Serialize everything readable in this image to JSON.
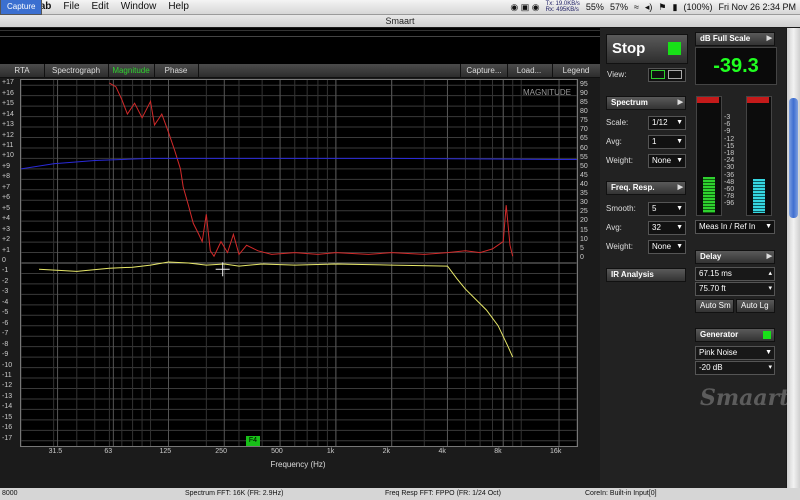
{
  "menubar": {
    "app": "Grab",
    "items": [
      "File",
      "Edit",
      "Capture",
      "Window",
      "Help"
    ],
    "selected": "Capture",
    "net_tx": "Tx: 19.0KB/s",
    "net_rx": "Rx: 495KB/s",
    "cpu": "55%",
    "mem": "57%",
    "battery": "(100%)",
    "clock": "Fri Nov 26  2:34 PM"
  },
  "window": {
    "title": "Smaart"
  },
  "tabs": {
    "left": [
      "RTA",
      "Spectrograph",
      "Magnitude",
      "Phase"
    ],
    "active": "Magnitude",
    "right": [
      "Capture...",
      "Load...",
      "Legend"
    ]
  },
  "plot": {
    "watermark": "MAGNITUDE",
    "marker": "F4",
    "xlabel": "Frequency (Hz)"
  },
  "chart_data": {
    "type": "line",
    "xscale": "log",
    "x_ticks": [
      "31.5",
      "63",
      "125",
      "250",
      "500",
      "1k",
      "2k",
      "4k",
      "8k",
      "16k"
    ],
    "left_axis_ticks": [
      "+17",
      "+16",
      "+15",
      "+14",
      "+13",
      "+12",
      "+11",
      "+10",
      "+9",
      "+8",
      "+7",
      "+6",
      "+5",
      "+4",
      "+3",
      "+2",
      "+1",
      "0",
      "-1",
      "-2",
      "-3",
      "-4",
      "-5",
      "-6",
      "-7",
      "-8",
      "-9",
      "-10",
      "-11",
      "-12",
      "-13",
      "-14",
      "-15",
      "-16",
      "-17"
    ],
    "right_axis_ticks": [
      "95",
      "90",
      "85",
      "80",
      "75",
      "70",
      "65",
      "60",
      "55",
      "50",
      "45",
      "40",
      "35",
      "30",
      "25",
      "20",
      "15",
      "10",
      "5",
      "0"
    ],
    "ylim_left": [
      -17.5,
      17.5
    ],
    "ylim_right": [
      0,
      97
    ],
    "series": [
      {
        "color": "#d22a2a",
        "axis": "right",
        "points": [
          [
            60,
            97
          ],
          [
            65,
            95
          ],
          [
            70,
            88
          ],
          [
            75,
            80
          ],
          [
            82,
            86
          ],
          [
            90,
            78
          ],
          [
            100,
            87
          ],
          [
            105,
            74
          ],
          [
            115,
            80
          ],
          [
            125,
            70
          ],
          [
            135,
            60
          ],
          [
            145,
            50
          ],
          [
            150,
            40
          ],
          [
            160,
            30
          ],
          [
            170,
            20
          ],
          [
            180,
            15
          ],
          [
            190,
            10
          ],
          [
            200,
            25
          ],
          [
            210,
            5
          ],
          [
            220,
            2
          ],
          [
            240,
            10
          ],
          [
            260,
            4
          ],
          [
            280,
            14
          ],
          [
            300,
            3
          ],
          [
            330,
            8
          ],
          [
            380,
            5
          ],
          [
            450,
            3
          ],
          [
            600,
            4
          ],
          [
            800,
            3
          ],
          [
            1000,
            4
          ],
          [
            1500,
            3
          ],
          [
            2000,
            4
          ],
          [
            3000,
            3
          ],
          [
            4000,
            4
          ],
          [
            5000,
            5
          ],
          [
            6000,
            4
          ],
          [
            7000,
            6
          ],
          [
            8000,
            10
          ],
          [
            8300,
            30
          ],
          [
            8700,
            8
          ],
          [
            9000,
            2
          ]
        ]
      },
      {
        "color": "#e8e86a",
        "axis": "left",
        "points": [
          [
            25,
            -0.6
          ],
          [
            40,
            -0.8
          ],
          [
            60,
            -0.5
          ],
          [
            80,
            -0.4
          ],
          [
            100,
            -0.2
          ],
          [
            125,
            0.1
          ],
          [
            160,
            0.0
          ],
          [
            200,
            -0.2
          ],
          [
            250,
            -0.1
          ],
          [
            300,
            -0.3
          ],
          [
            400,
            -0.1
          ],
          [
            600,
            -0.2
          ],
          [
            1000,
            -0.1
          ],
          [
            2000,
            -0.2
          ],
          [
            4000,
            -0.3
          ],
          [
            4500,
            -1.5
          ],
          [
            5000,
            -2.5
          ],
          [
            6500,
            -4.5
          ],
          [
            7500,
            -6.0
          ],
          [
            8500,
            -8.0
          ],
          [
            9000,
            -9.0
          ]
        ]
      },
      {
        "color": "#2a2ad8",
        "axis": "left",
        "points": [
          [
            20,
            9.0
          ],
          [
            30,
            9.5
          ],
          [
            50,
            9.8
          ],
          [
            100,
            10.0
          ],
          [
            500,
            10.0
          ],
          [
            2000,
            10.0
          ],
          [
            16000,
            9.9
          ],
          [
            20000,
            9.9
          ]
        ]
      }
    ]
  },
  "panel": {
    "stop_label": "Stop",
    "view_label": "View:",
    "db_fullscale_label": "dB Full Scale",
    "db_value": "-39.3",
    "spectrum_label": "Spectrum",
    "scale_label": "Scale:",
    "scale_value": "1/12",
    "avg_label": "Avg:",
    "avg_value": "1",
    "weight_label": "Weight:",
    "weight_value": "None",
    "freqresp_label": "Freq. Resp.",
    "smooth_label": "Smooth:",
    "smooth_value": "5",
    "avg2_value": "32",
    "weight2_value": "None",
    "ir_label": "IR Analysis",
    "meas_label": "Meas In / Ref In",
    "meter_scale": [
      "-3",
      "-6",
      "-9",
      "-12",
      "-15",
      "-18",
      "-24",
      "-30",
      "-36",
      "-48",
      "-60",
      "-78",
      "-96"
    ],
    "delay_label": "Delay",
    "delay_ms": "67.15 ms",
    "delay_ft": "75.70 ft",
    "auto_sm": "Auto Sm",
    "auto_lg": "Auto Lg",
    "generator_label": "Generator",
    "gen_type": "Pink Noise",
    "gen_level": "-20 dB",
    "logo": "Smaart",
    "colors": {
      "green": "#18e018",
      "panel": "#222222",
      "header": "#444444"
    }
  },
  "status": {
    "left": "8000",
    "spectrum": "Spectrum FFT: 16K (FR: 2.9Hz)",
    "freqresp": "Freq Resp FFT: FPPO (FR: 1/24 Oct)",
    "input": "CoreIn: Built-in Input[0]"
  }
}
